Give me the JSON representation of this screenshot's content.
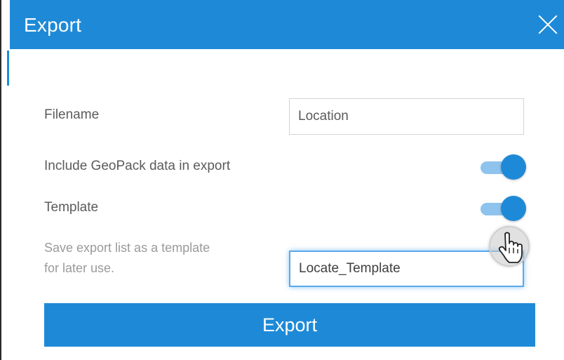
{
  "dialog": {
    "title": "Export",
    "close_icon": "close-icon",
    "filename_label": "Filename",
    "filename_value": "Location",
    "geopack_label": "Include GeoPack data in export",
    "geopack_enabled": true,
    "template_label": "Template",
    "template_enabled": true,
    "template_hint_line1": "Save export list as a template",
    "template_hint_line2": "for later use.",
    "template_name_value": "Locate_Template",
    "export_button_label": "Export"
  },
  "colors": {
    "accent": "#1e8ad7",
    "toggle_track": "#8ec3ee",
    "label_text": "#5b5b5b",
    "hint_text": "#9a9a9a"
  },
  "cursor_icon": "hand-pointer-icon"
}
